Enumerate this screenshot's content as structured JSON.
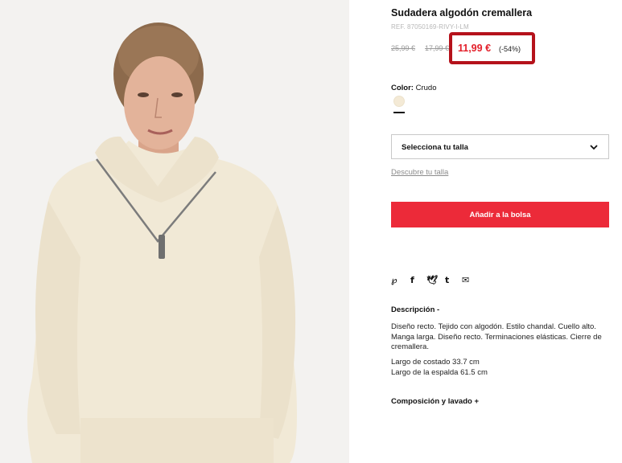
{
  "product": {
    "title": "Sudadera algodón cremallera",
    "ref": "REF. 87050169-RIVY-I-LM",
    "old_price_1": "25,99 €",
    "old_price_2": "17,99 €",
    "price": "11,99 €",
    "discount": "(-54%)",
    "highlight_color": "#b5121b",
    "price_color": "#e3202b"
  },
  "color": {
    "label": "Color:",
    "value": "Crudo",
    "swatch_hex": "#f4ead6"
  },
  "size": {
    "select_label": "Selecciona tu talla",
    "guide_link": "Descubre tu talla"
  },
  "cart": {
    "add_button": "Añadir a la bolsa",
    "button_color": "#ec2a39"
  },
  "share": {
    "icons": [
      "pinterest-icon",
      "facebook-icon",
      "twitter-icon",
      "tumblr-icon",
      "mail-icon"
    ],
    "glyphs": [
      "℘",
      "f",
      "🕊",
      "t",
      "✉"
    ]
  },
  "description": {
    "heading": "Descripción -",
    "body": "Diseño recto. Tejido con algodón. Estilo chandal. Cuello alto. Manga larga. Diseño recto. Terminaciones elásticas. Cierre de cremallera.",
    "measure_1": "Largo de costado 33.7 cm",
    "measure_2": "Largo de la espalda 61.5 cm"
  },
  "composition": {
    "heading": "Composición y lavado +"
  }
}
